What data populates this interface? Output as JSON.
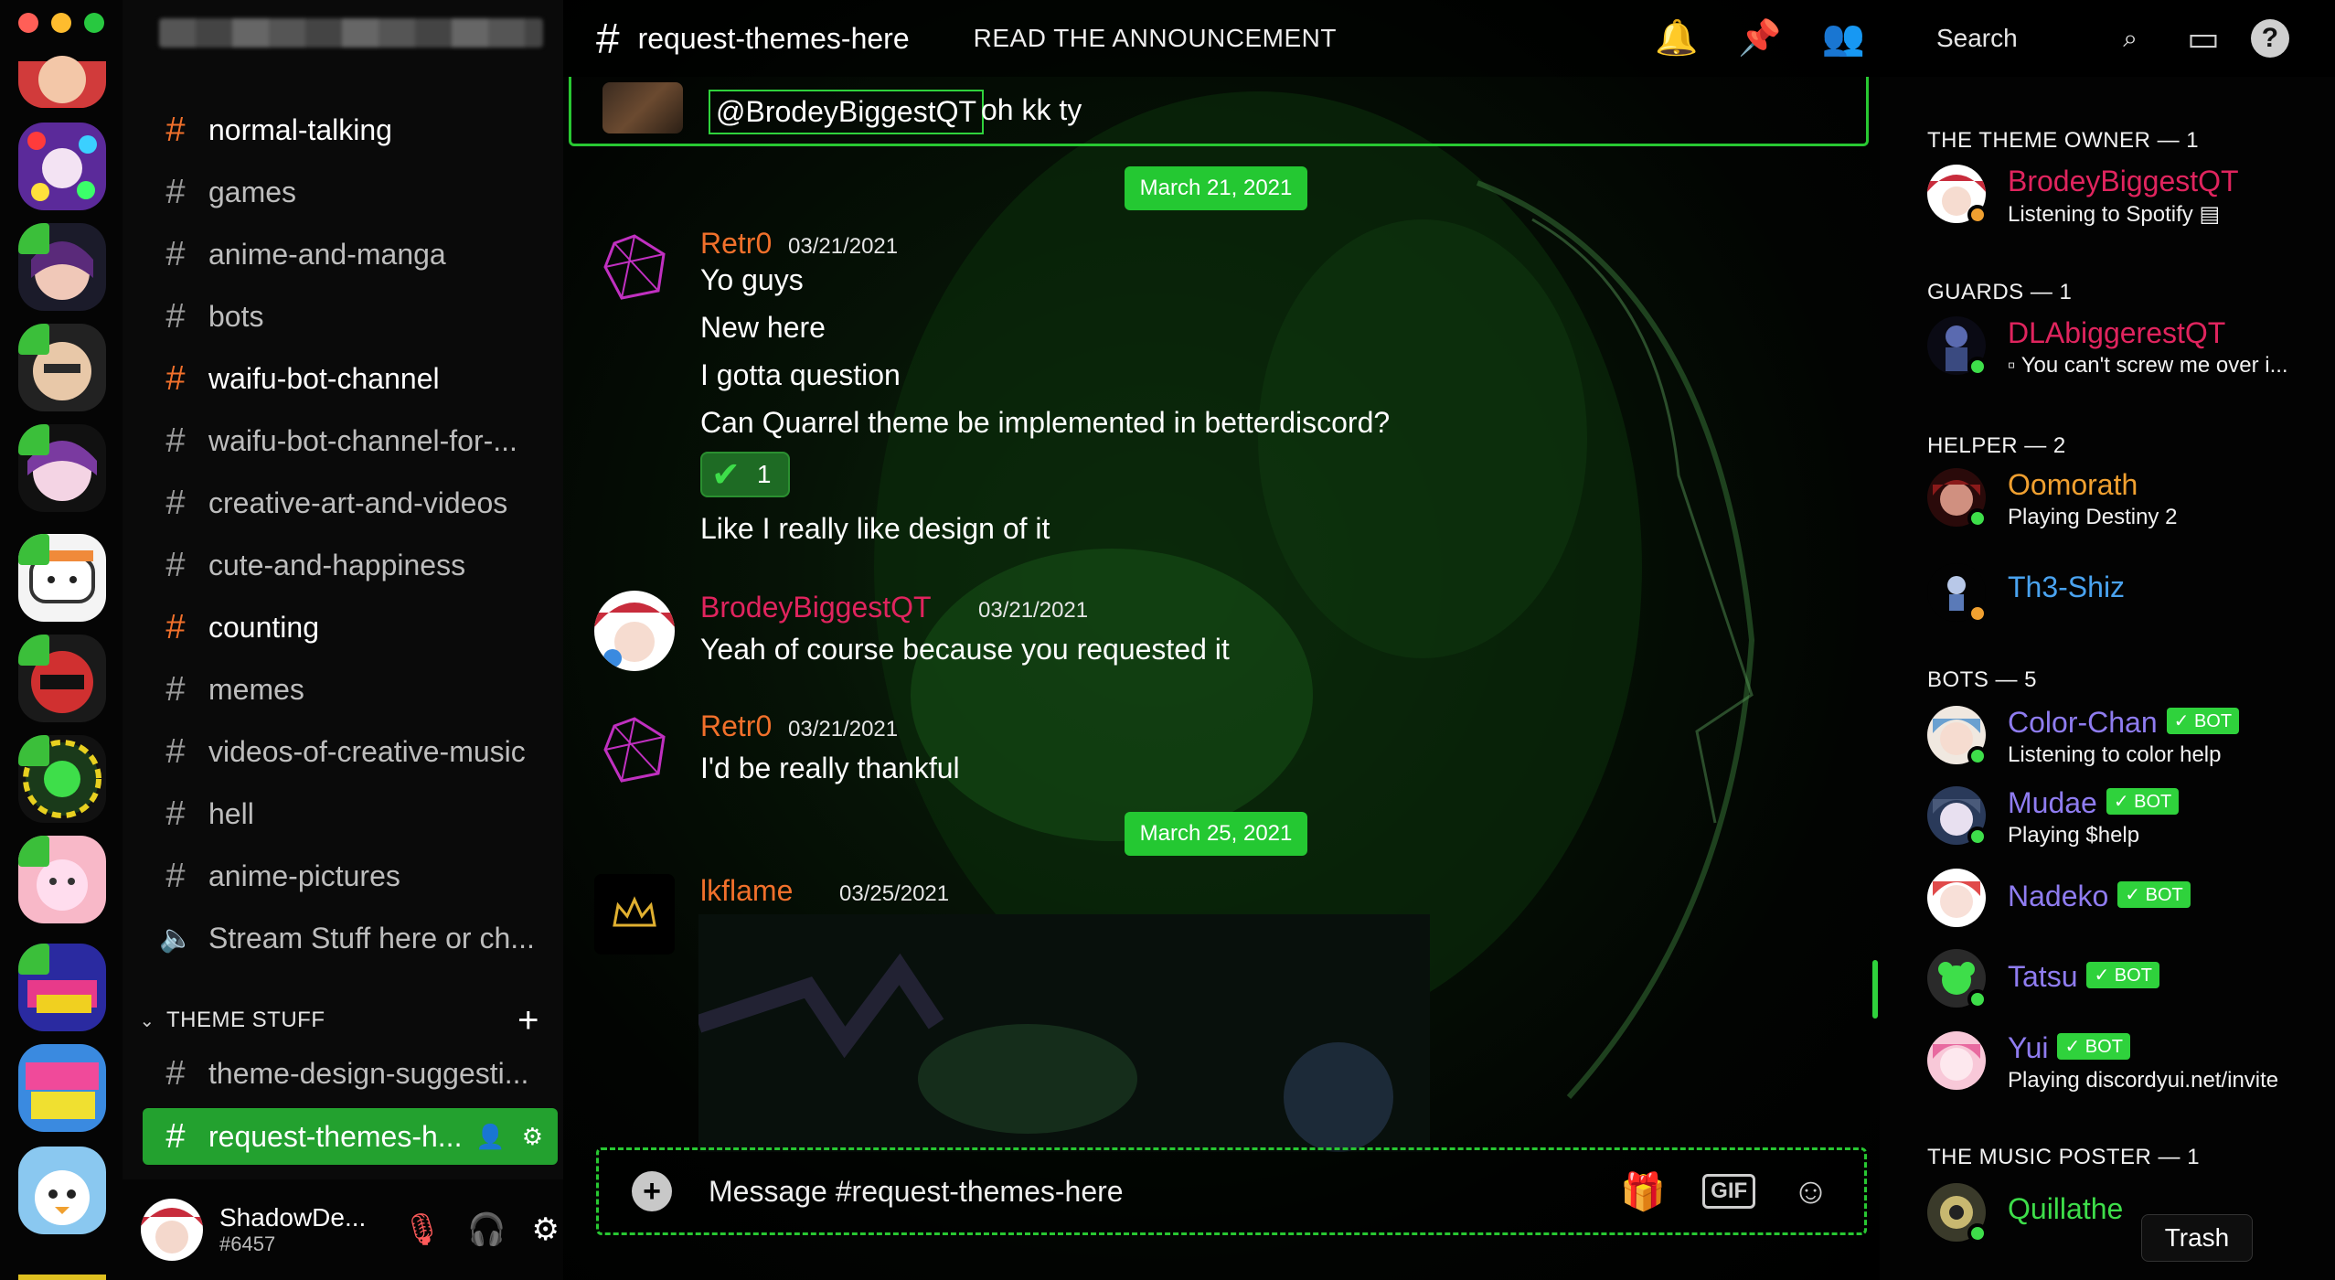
{
  "window": {
    "traffic_colors": [
      "#ff5f57",
      "#febc2e",
      "#28c840"
    ]
  },
  "channels": {
    "items": [
      {
        "label": "normal-talking",
        "unread": true
      },
      {
        "label": "games",
        "unread": false
      },
      {
        "label": "anime-and-manga",
        "unread": false
      },
      {
        "label": "bots",
        "unread": false
      },
      {
        "label": "waifu-bot-channel",
        "unread": true
      },
      {
        "label": "waifu-bot-channel-for-...",
        "unread": false
      },
      {
        "label": "creative-art-and-videos",
        "unread": false
      },
      {
        "label": "cute-and-happiness",
        "unread": false
      },
      {
        "label": "counting",
        "unread": true
      },
      {
        "label": "memes",
        "unread": false
      },
      {
        "label": "videos-of-creative-music",
        "unread": false
      },
      {
        "label": "hell",
        "unread": false
      },
      {
        "label": "anime-pictures",
        "unread": false
      },
      {
        "label": "Stream Stuff here or ch...",
        "voice": true
      }
    ],
    "category": "THEME STUFF",
    "theme_items": [
      "theme-design-suggesti...",
      "request-themes-h..."
    ]
  },
  "user": {
    "name": "ShadowDe...",
    "tag": "#6457"
  },
  "header": {
    "channel_name": "request-themes-here",
    "topic": "READ THE ANNOUNCEMENT",
    "search_placeholder": "Search"
  },
  "chat": {
    "quoted": {
      "mention": "@BrodeyBiggestQT",
      "text": "oh kk ty"
    },
    "dates": [
      "March 21, 2021",
      "March 25, 2021"
    ],
    "messages": [
      {
        "author": "Retr0",
        "color": "#f1702b",
        "timestamp": "03/21/2021",
        "lines": [
          "Yo guys",
          "New here",
          "I gotta question",
          "Can Quarrel theme be implemented in betterdiscord?"
        ],
        "reaction_count": "1",
        "after_reaction": "Like I really like design of it"
      },
      {
        "author": "BrodeyBiggestQT",
        "color": "#e0245e",
        "timestamp": "03/21/2021",
        "lines": [
          "Yeah of course because you requested it"
        ]
      },
      {
        "author": "Retr0",
        "color": "#f1702b",
        "timestamp": "03/21/2021",
        "lines": [
          "I'd be really thankful"
        ]
      },
      {
        "author": "lkflame",
        "color": "#f1702b",
        "timestamp": "03/25/2021",
        "lines": []
      }
    ],
    "composer_placeholder": "Message #request-themes-here",
    "gif_label": "GIF"
  },
  "members": {
    "groups": [
      {
        "label": "THE THEME OWNER — 1",
        "members": [
          {
            "name": "BrodeyBiggestQT",
            "color": "#e0245e",
            "activity": "Listening to Spotify"
          }
        ]
      },
      {
        "label": "GUARDS — 1",
        "members": [
          {
            "name": "DLAbiggerestQT",
            "color": "#e0245e",
            "activity": "You can't screw me over i..."
          }
        ]
      },
      {
        "label": "HELPER — 2",
        "members": [
          {
            "name": "Oomorath",
            "color": "#f0a030",
            "activity": "Playing Destiny 2"
          },
          {
            "name": "Th3-Shiz",
            "color": "#4aa3f0",
            "activity": ""
          }
        ]
      },
      {
        "label": "BOTS — 5",
        "members": [
          {
            "name": "Color-Chan",
            "color": "#8f7cf0",
            "activity": "Listening to color help"
          },
          {
            "name": "Mudae",
            "color": "#8f7cf0",
            "activity": "Playing $help"
          },
          {
            "name": "Nadeko",
            "color": "#8f7cf0",
            "activity": ""
          },
          {
            "name": "Tatsu",
            "color": "#8f7cf0",
            "activity": ""
          },
          {
            "name": "Yui",
            "color": "#8f7cf0",
            "activity": "Playing discordyui.net/invite"
          }
        ]
      },
      {
        "label": "THE MUSIC POSTER — 1",
        "members": [
          {
            "name": "Quillathe",
            "color": "#3ede4a",
            "activity": ""
          }
        ]
      }
    ],
    "bot_badge": "✓ BOT"
  },
  "tooltip": "Trash",
  "accent": "#28c832",
  "icons": [
    "bell-icon",
    "pin-icon",
    "members-icon",
    "search-icon",
    "inbox-icon",
    "help-icon",
    "gift-icon",
    "emoji-icon",
    "mute-mic-icon",
    "headphones-icon",
    "gear-icon"
  ]
}
